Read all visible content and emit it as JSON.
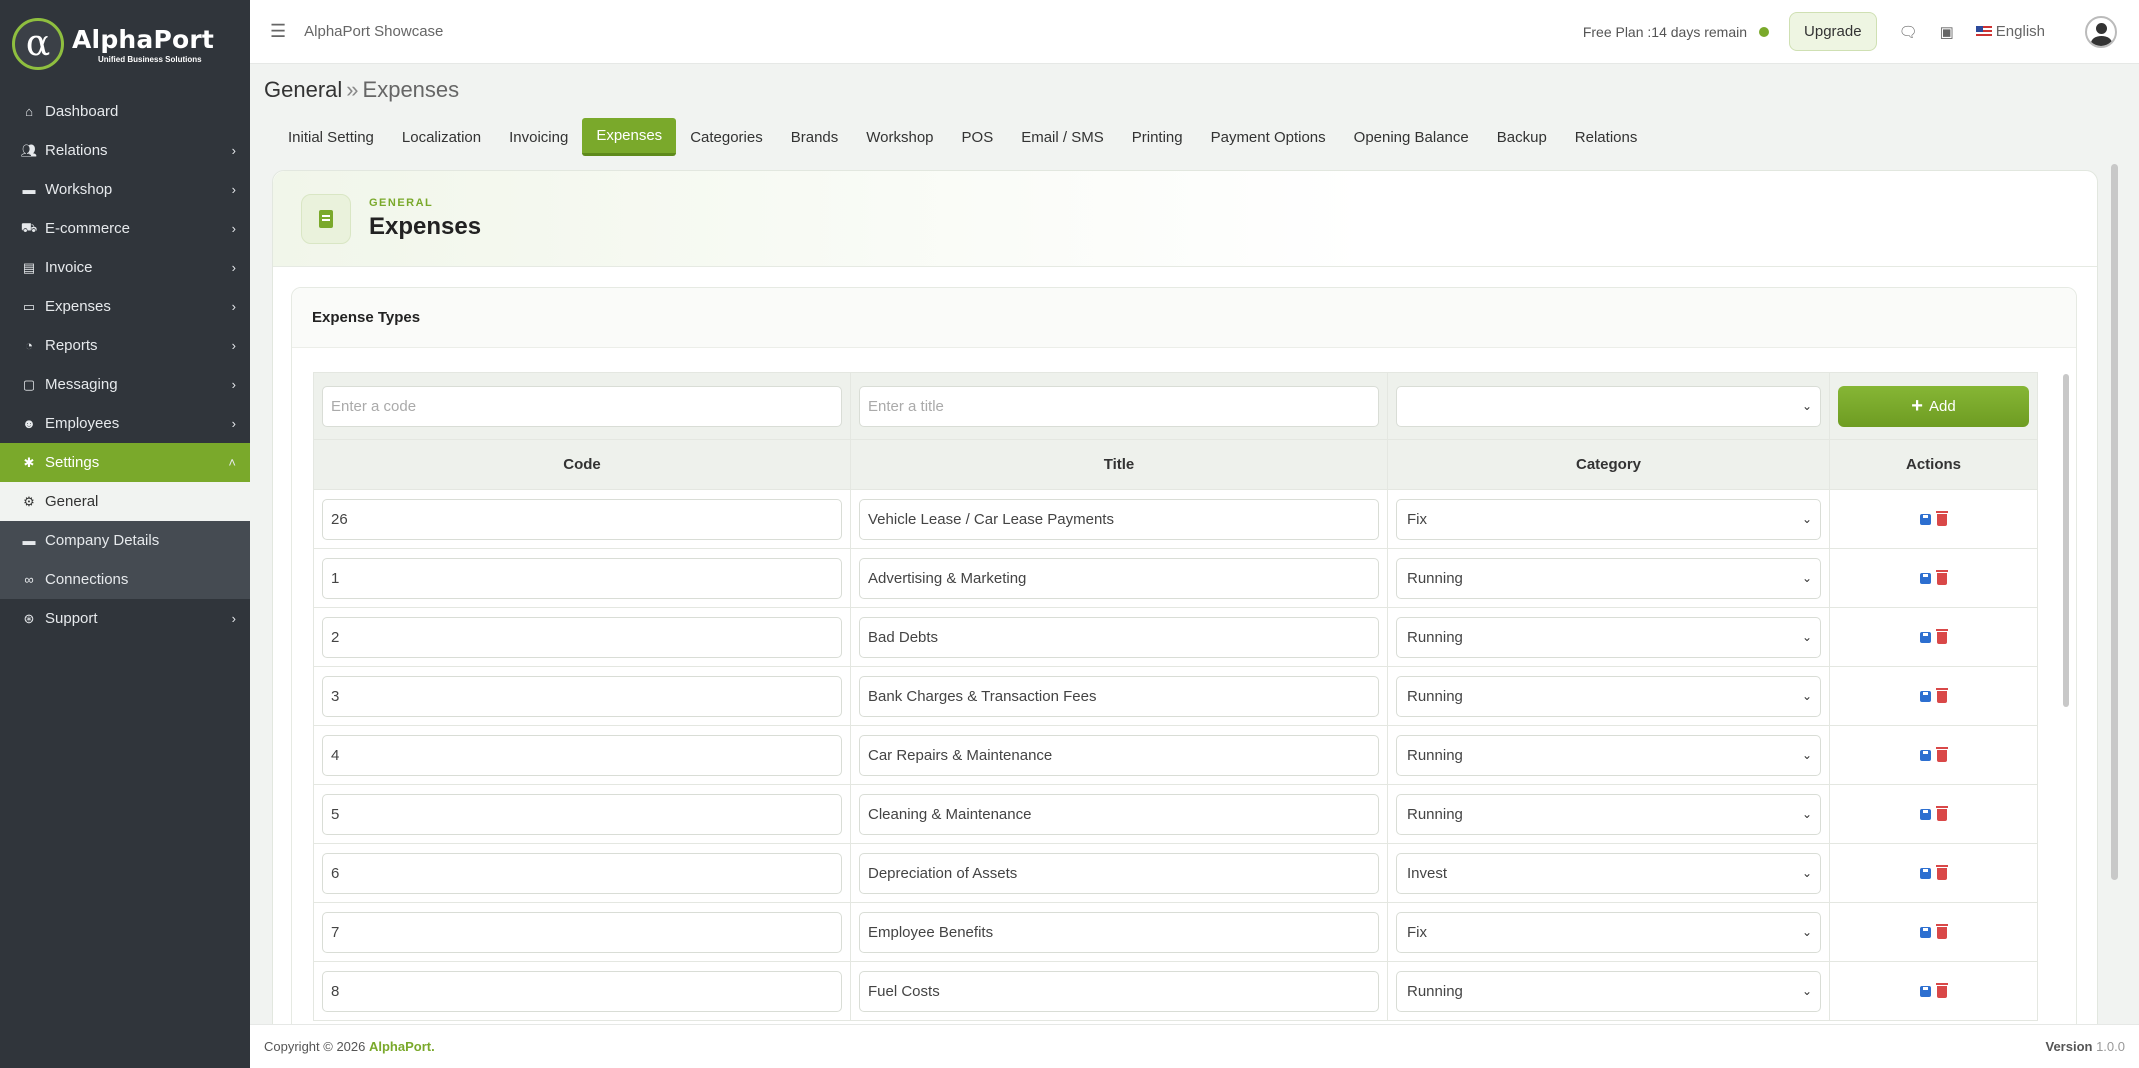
{
  "brand": {
    "logo_glyph": "α",
    "name": "AlphaPort",
    "tagline": "Unified Business Solutions",
    "accent_color": "#7aa92b"
  },
  "sidebar": {
    "items": [
      {
        "label": "Dashboard",
        "icon": "home-icon"
      },
      {
        "label": "Relations",
        "icon": "users-icon"
      },
      {
        "label": "Workshop",
        "icon": "briefcase-icon"
      },
      {
        "label": "E-commerce",
        "icon": "cart-icon"
      },
      {
        "label": "Invoice",
        "icon": "invoice-icon"
      },
      {
        "label": "Expenses",
        "icon": "money-icon"
      },
      {
        "label": "Reports",
        "icon": "pie-chart-icon"
      },
      {
        "label": "Messaging",
        "icon": "message-icon"
      },
      {
        "label": "Employees",
        "icon": "user-group-icon"
      },
      {
        "label": "Settings",
        "icon": "tools-icon"
      },
      {
        "label": "General",
        "icon": "gear-icon"
      },
      {
        "label": "Company Details",
        "icon": "building-icon"
      },
      {
        "label": "Connections",
        "icon": "link-icon"
      },
      {
        "label": "Support",
        "icon": "lifebuoy-icon"
      }
    ]
  },
  "topbar": {
    "app_name": "AlphaPort Showcase",
    "plan_text": "Free Plan :14 days remain",
    "upgrade_label": "Upgrade",
    "language": "English"
  },
  "breadcrumb": {
    "parent": "General",
    "separator": "»",
    "current": "Expenses"
  },
  "tabs": [
    "Initial Setting",
    "Localization",
    "Invoicing",
    "Expenses",
    "Categories",
    "Brands",
    "Workshop",
    "POS",
    "Email / SMS",
    "Printing",
    "Payment Options",
    "Opening Balance",
    "Backup",
    "Relations"
  ],
  "active_tab": "Expenses",
  "card": {
    "kicker": "GENERAL",
    "title": "Expenses"
  },
  "panel": {
    "title": "Expense Types",
    "code_placeholder": "Enter a code",
    "title_placeholder": "Enter a title",
    "add_label": "Add",
    "columns": [
      "Code",
      "Title",
      "Category",
      "Actions"
    ],
    "rows": [
      {
        "code": "26",
        "title": "Vehicle Lease / Car Lease Payments",
        "category": "Fix"
      },
      {
        "code": "1",
        "title": "Advertising & Marketing",
        "category": "Running"
      },
      {
        "code": "2",
        "title": "Bad Debts",
        "category": "Running"
      },
      {
        "code": "3",
        "title": "Bank Charges & Transaction Fees",
        "category": "Running"
      },
      {
        "code": "4",
        "title": "Car Repairs & Maintenance",
        "category": "Running"
      },
      {
        "code": "5",
        "title": "Cleaning & Maintenance",
        "category": "Running"
      },
      {
        "code": "6",
        "title": "Depreciation of Assets",
        "category": "Invest"
      },
      {
        "code": "7",
        "title": "Employee Benefits",
        "category": "Fix"
      },
      {
        "code": "8",
        "title": "Fuel Costs",
        "category": "Running"
      }
    ]
  },
  "footer": {
    "copyright": "Copyright © 2026",
    "brand": "AlphaPort.",
    "version_label": "Version",
    "version": "1.0.0"
  }
}
